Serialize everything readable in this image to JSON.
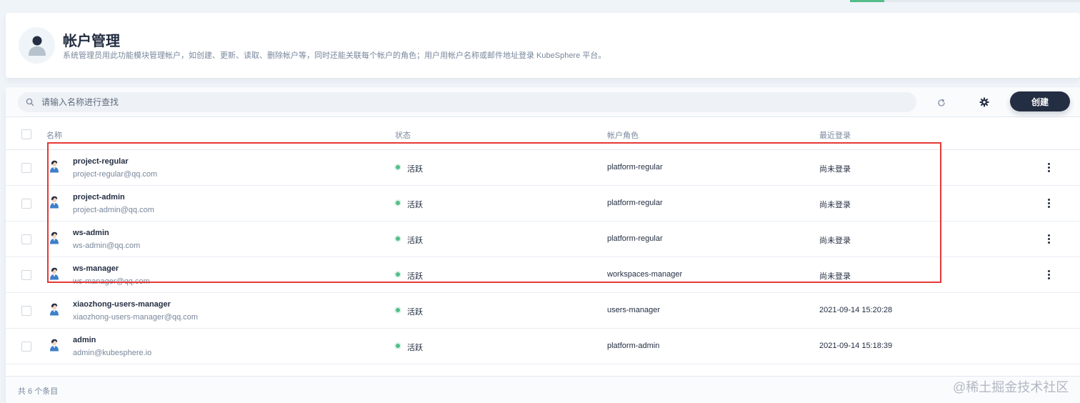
{
  "header": {
    "title": "帐户管理",
    "description": "系统管理员用此功能模块管理帐户，如创建、更新、读取、删除帐户等，同时还能关联每个帐户的角色；用户用帐户名称或邮件地址登录 KubeSphere 平台。"
  },
  "toolbar": {
    "search_placeholder": "请输入名称进行查找",
    "create_label": "创建"
  },
  "table": {
    "columns": {
      "name": "名称",
      "status": "状态",
      "role": "帐户角色",
      "last_login": "最近登录"
    },
    "rows": [
      {
        "name": "project-regular",
        "email": "project-regular@qq.com",
        "status": "活跃",
        "role": "platform-regular",
        "last_login": "尚未登录"
      },
      {
        "name": "project-admin",
        "email": "project-admin@qq.com",
        "status": "活跃",
        "role": "platform-regular",
        "last_login": "尚未登录"
      },
      {
        "name": "ws-admin",
        "email": "ws-admin@qq.com",
        "status": "活跃",
        "role": "platform-regular",
        "last_login": "尚未登录"
      },
      {
        "name": "ws-manager",
        "email": "ws-manager@qq.com",
        "status": "活跃",
        "role": "workspaces-manager",
        "last_login": "尚未登录"
      },
      {
        "name": "xiaozhong-users-manager",
        "email": "xiaozhong-users-manager@qq.com",
        "status": "活跃",
        "role": "users-manager",
        "last_login": "2021-09-14 15:20:28"
      },
      {
        "name": "admin",
        "email": "admin@kubesphere.io",
        "status": "活跃",
        "role": "platform-admin",
        "last_login": "2021-09-14 15:18:39"
      }
    ]
  },
  "footer": {
    "total": "共 6 个条目"
  },
  "watermark": "@稀土掘金技术社区",
  "colors": {
    "accent_dark": "#242e42",
    "status_active": "#55bc8a",
    "highlight": "#e53935"
  }
}
